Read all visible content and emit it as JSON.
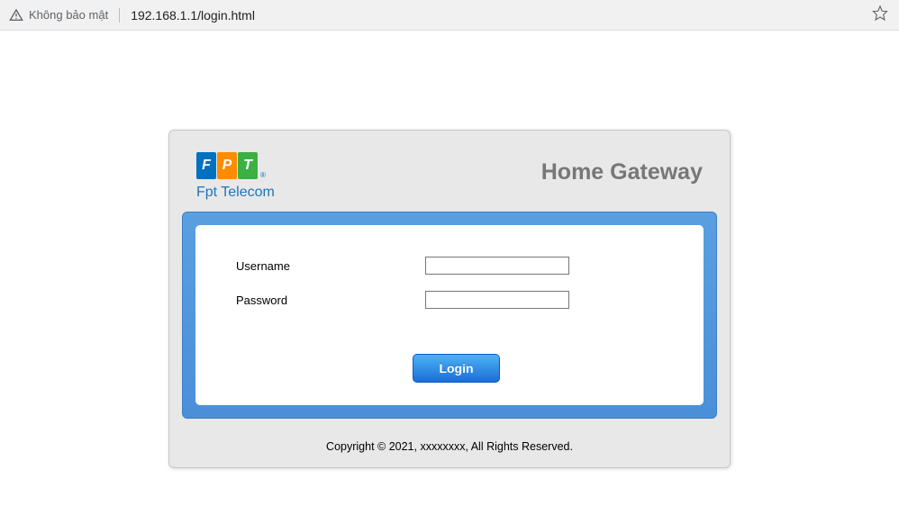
{
  "browser": {
    "security_text": "Không bảo mật",
    "url": "192.168.1.1/login.html"
  },
  "header": {
    "brand_name": "Fpt Telecom",
    "title": "Home Gateway"
  },
  "form": {
    "username_label": "Username",
    "username_value": "",
    "password_label": "Password",
    "password_value": "",
    "login_button": "Login"
  },
  "footer": {
    "copyright": "Copyright © 2021, xxxxxxxx, All Rights Reserved."
  }
}
